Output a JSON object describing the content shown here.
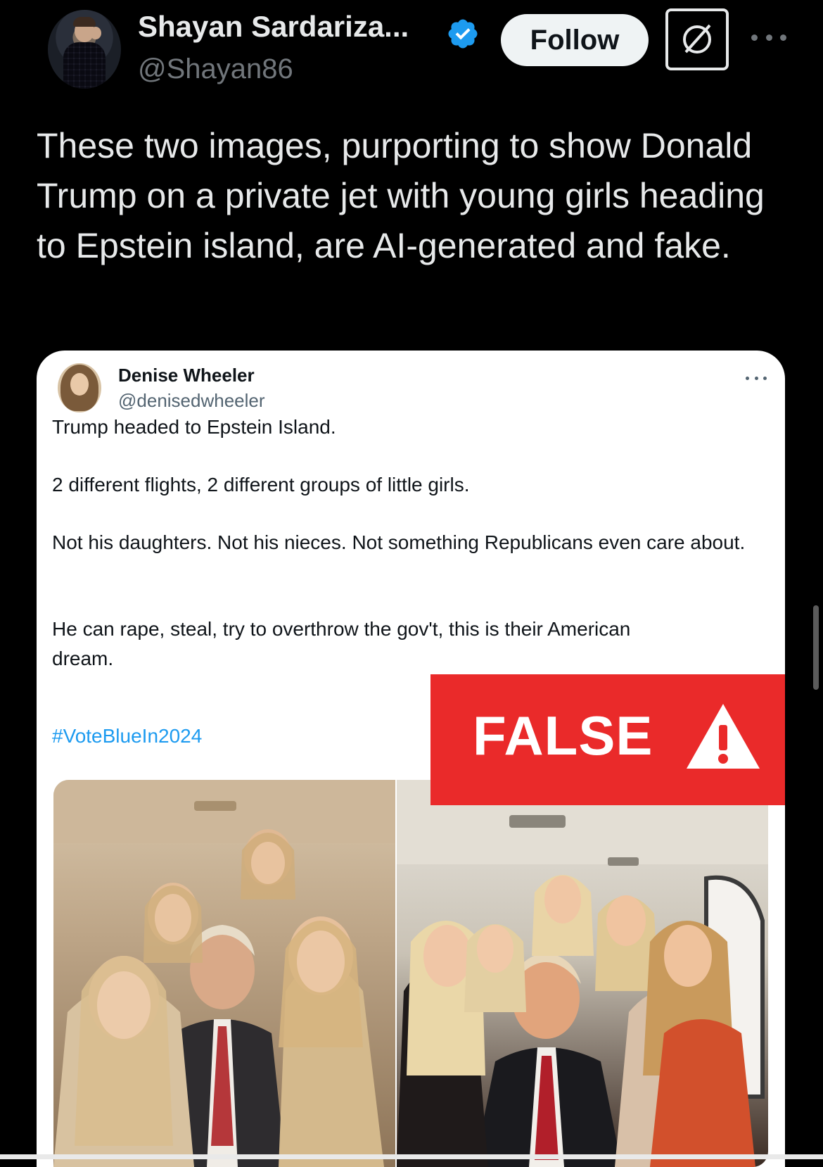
{
  "tweet": {
    "author_name": "Shayan Sardariza...",
    "author_handle": "@Shayan86",
    "follow_label": "Follow",
    "text": "These two images, purporting to show Donald Trump on a private jet with young girls heading to Epstein island, are AI-generated and fake."
  },
  "quoted_tweet": {
    "author_name": "Denise Wheeler",
    "author_handle": "@denisedwheeler",
    "paragraphs": [
      "Trump headed to Epstein Island.",
      "2 different flights, 2 different groups of little girls.",
      "Not his daughters. Not his nieces. Not something Republicans even care about.",
      "He can rape, steal, try to overthrow the gov't, this is their American dream."
    ],
    "hashtag": "#VoteBlueIn2024"
  },
  "overlay": {
    "label": "FALSE",
    "color": "#ea2a2a"
  },
  "colors": {
    "background": "#000000",
    "accent": "#1d9bf0",
    "verified": "#1d9bf0"
  }
}
